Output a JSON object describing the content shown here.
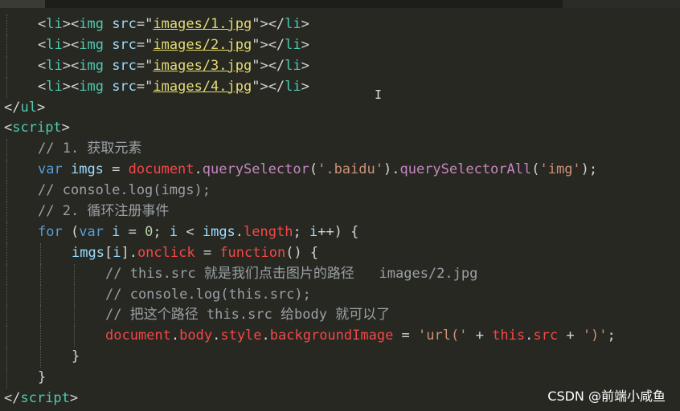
{
  "editor": {
    "lines": [
      {
        "indent": 1,
        "tokens": [
          [
            "p",
            "<"
          ],
          [
            "t",
            "li"
          ],
          [
            "p",
            "><"
          ],
          [
            "t",
            "img"
          ],
          [
            "p",
            " "
          ],
          [
            "a",
            "src"
          ],
          [
            "p",
            "=\""
          ],
          [
            "sy",
            "images/1.jpg"
          ],
          [
            "p",
            "\"></"
          ],
          [
            "t",
            "li"
          ],
          [
            "p",
            ">"
          ]
        ]
      },
      {
        "indent": 1,
        "tokens": [
          [
            "p",
            "<"
          ],
          [
            "t",
            "li"
          ],
          [
            "p",
            "><"
          ],
          [
            "t",
            "img"
          ],
          [
            "p",
            " "
          ],
          [
            "a",
            "src"
          ],
          [
            "p",
            "=\""
          ],
          [
            "sy",
            "images/2.jpg"
          ],
          [
            "p",
            "\"></"
          ],
          [
            "t",
            "li"
          ],
          [
            "p",
            ">"
          ]
        ]
      },
      {
        "indent": 1,
        "tokens": [
          [
            "p",
            "<"
          ],
          [
            "t",
            "li"
          ],
          [
            "p",
            "><"
          ],
          [
            "t",
            "img"
          ],
          [
            "p",
            " "
          ],
          [
            "a",
            "src"
          ],
          [
            "p",
            "=\""
          ],
          [
            "sy",
            "images/3.jpg"
          ],
          [
            "p",
            "\"></"
          ],
          [
            "t",
            "li"
          ],
          [
            "p",
            ">"
          ]
        ]
      },
      {
        "indent": 1,
        "tokens": [
          [
            "p",
            "<"
          ],
          [
            "t",
            "li"
          ],
          [
            "p",
            "><"
          ],
          [
            "t",
            "img"
          ],
          [
            "p",
            " "
          ],
          [
            "a",
            "src"
          ],
          [
            "p",
            "=\""
          ],
          [
            "sy",
            "images/4.jpg"
          ],
          [
            "p",
            "\"></"
          ],
          [
            "t",
            "li"
          ],
          [
            "p",
            ">"
          ]
        ]
      },
      {
        "indent": 0,
        "tokens": [
          [
            "p",
            "</"
          ],
          [
            "t",
            "ul"
          ],
          [
            "p",
            ">"
          ]
        ]
      },
      {
        "indent": 0,
        "tokens": [
          [
            "p",
            "<"
          ],
          [
            "t",
            "script"
          ],
          [
            "p",
            ">"
          ]
        ]
      },
      {
        "indent": 1,
        "tokens": [
          [
            "c",
            "// 1. 获取元素"
          ]
        ]
      },
      {
        "indent": 1,
        "tokens": [
          [
            "k",
            "var"
          ],
          [
            "p",
            " "
          ],
          [
            "v",
            "imgs"
          ],
          [
            "p",
            " = "
          ],
          [
            "r",
            "document"
          ],
          [
            "p",
            "."
          ],
          [
            "m",
            "querySelector"
          ],
          [
            "p",
            "("
          ],
          [
            "q",
            "'.baidu'"
          ],
          [
            "p",
            ")."
          ],
          [
            "m",
            "querySelectorAll"
          ],
          [
            "p",
            "("
          ],
          [
            "q",
            "'img'"
          ],
          [
            "p",
            ");"
          ]
        ]
      },
      {
        "indent": 1,
        "tokens": [
          [
            "c",
            "// console.log(imgs);"
          ]
        ]
      },
      {
        "indent": 1,
        "tokens": [
          [
            "c",
            "// 2. 循环注册事件"
          ]
        ]
      },
      {
        "indent": 1,
        "tokens": [
          [
            "k",
            "for"
          ],
          [
            "p",
            " ("
          ],
          [
            "k",
            "var"
          ],
          [
            "p",
            " "
          ],
          [
            "v",
            "i"
          ],
          [
            "p",
            " = "
          ],
          [
            "n",
            "0"
          ],
          [
            "p",
            "; "
          ],
          [
            "v",
            "i"
          ],
          [
            "p",
            " < "
          ],
          [
            "v",
            "imgs"
          ],
          [
            "p",
            "."
          ],
          [
            "r",
            "length"
          ],
          [
            "p",
            "; "
          ],
          [
            "v",
            "i"
          ],
          [
            "p",
            "++) {"
          ]
        ]
      },
      {
        "indent": 2,
        "tokens": [
          [
            "v",
            "imgs"
          ],
          [
            "p",
            "["
          ],
          [
            "v",
            "i"
          ],
          [
            "p",
            "]."
          ],
          [
            "r",
            "onclick"
          ],
          [
            "p",
            " = "
          ],
          [
            "r",
            "function"
          ],
          [
            "p",
            "() {"
          ]
        ]
      },
      {
        "indent": 3,
        "tokens": [
          [
            "c",
            "// this.src 就是我们点击图片的路径   images/2.jpg"
          ]
        ]
      },
      {
        "indent": 3,
        "tokens": [
          [
            "c",
            "// console.log(this.src);"
          ]
        ]
      },
      {
        "indent": 3,
        "tokens": [
          [
            "c",
            "// 把这个路径 this.src 给body 就可以了"
          ]
        ]
      },
      {
        "indent": 3,
        "tokens": [
          [
            "r",
            "document"
          ],
          [
            "p",
            "."
          ],
          [
            "r",
            "body"
          ],
          [
            "p",
            "."
          ],
          [
            "r",
            "style"
          ],
          [
            "p",
            "."
          ],
          [
            "r",
            "backgroundImage"
          ],
          [
            "p",
            " = "
          ],
          [
            "q",
            "'url('"
          ],
          [
            "p",
            " + "
          ],
          [
            "r",
            "this"
          ],
          [
            "p",
            "."
          ],
          [
            "r",
            "src"
          ],
          [
            "p",
            " + "
          ],
          [
            "q",
            "')'"
          ],
          [
            "p",
            ";"
          ]
        ]
      },
      {
        "indent": 2,
        "tokens": [
          [
            "p",
            "}"
          ]
        ]
      },
      {
        "indent": 1,
        "tokens": [
          [
            "p",
            "}"
          ]
        ]
      },
      {
        "indent": 0,
        "tokens": [
          [
            "p",
            "</"
          ],
          [
            "t",
            "script"
          ],
          [
            "p",
            ">"
          ]
        ]
      }
    ]
  },
  "watermark": "CSDN @前端小咸鱼",
  "cursor_glyph": "I"
}
